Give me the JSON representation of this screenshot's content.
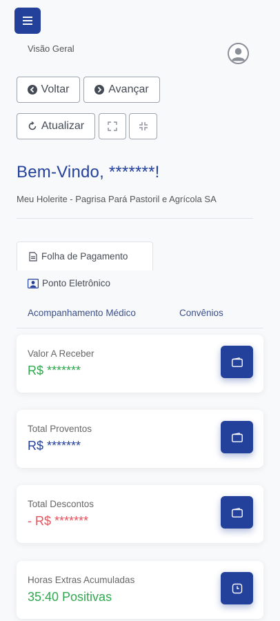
{
  "header": {
    "page_label": "Visão Geral"
  },
  "toolbar": {
    "back_label": "Voltar",
    "forward_label": "Avançar",
    "refresh_label": "Atualizar"
  },
  "welcome": {
    "title": "Bem-Vindo, *******!",
    "subtitle": "Meu Holerite - Pagrisa Pará Pastoril e Agrícola SA"
  },
  "tabs": [
    {
      "label": "Folha de Pagamento",
      "active": true
    },
    {
      "label": "Ponto Eletrônico"
    },
    {
      "label": "Acompanhamento Médico"
    },
    {
      "label": "Convênios"
    }
  ],
  "cards": [
    {
      "label": "Valor A Receber",
      "value": "R$ *******",
      "color": "#2fa84f",
      "icon": "wallet-icon"
    },
    {
      "label": "Total Proventos",
      "value": "R$ *******",
      "color": "#23409b",
      "icon": "wallet-icon"
    },
    {
      "label": "Total Descontos",
      "value": "- R$ *******",
      "color": "#e8505b",
      "icon": "wallet-icon"
    },
    {
      "label": "Horas Extras Acumuladas",
      "value": "35:40 Positivas",
      "color": "#2fa84f",
      "icon": "clock-icon"
    }
  ],
  "colors": {
    "primary": "#23409b",
    "positive": "#2fa84f",
    "negative": "#e8505b"
  }
}
